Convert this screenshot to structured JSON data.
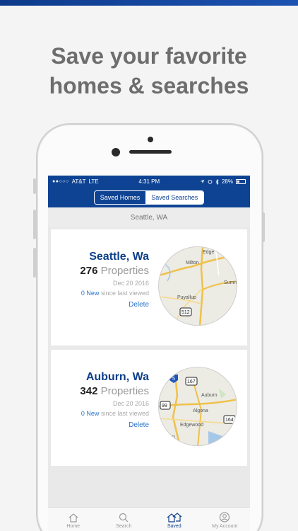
{
  "headline": {
    "line1": "Save your favorite",
    "line2": "homes & searches"
  },
  "status_bar": {
    "signal": "●●○○○",
    "carrier": "AT&T",
    "network": "LTE",
    "time": "4:31 PM",
    "battery": "28%"
  },
  "segmented": {
    "saved_homes": "Saved Homes",
    "saved_searches": "Saved Searches",
    "active": "saved_searches"
  },
  "location_header": "Seattle, WA",
  "searches": [
    {
      "city": "Seattle, Wa",
      "count": "276",
      "count_label": "Properties",
      "date": "Dec 20 2016",
      "new_count": "0 New",
      "new_label": "since last viewed",
      "delete_label": "Delete",
      "map_labels": [
        "Edge",
        "Milton",
        "Sumn",
        "Puyallup"
      ],
      "map_shields": [
        "512"
      ]
    },
    {
      "city": "Auburn, Wa",
      "count": "342",
      "count_label": "Properties",
      "date": "Dec 20 2016",
      "new_count": "0 New",
      "new_label": "since last viewed",
      "delete_label": "Delete",
      "map_labels": [
        "Auburn",
        "Algona",
        "Edgewood",
        "ilton"
      ],
      "map_shields": [
        "5",
        "167",
        "99",
        "164"
      ]
    }
  ],
  "tabs": [
    {
      "label": "Home",
      "icon": "house-icon"
    },
    {
      "label": "Search",
      "icon": "search-icon"
    },
    {
      "label": "Saved",
      "icon": "saved-houses-icon"
    },
    {
      "label": "My Account",
      "icon": "account-icon"
    }
  ],
  "colors": {
    "brand_blue": "#0e4393",
    "link_blue": "#2a73c9",
    "headline_gray": "#6d6d6d"
  }
}
